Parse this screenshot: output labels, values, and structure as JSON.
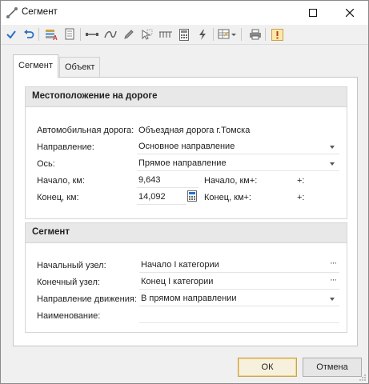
{
  "window": {
    "title": "Сегмент"
  },
  "toolbar": {
    "items": [
      "check-icon",
      "undo-icon",
      "layers-text-icon",
      "document-icon",
      "ruler-icon",
      "curve-icon",
      "pencil-icon",
      "select-arrow-icon",
      "measure-ticks-icon",
      "calculator-icon",
      "lightning-icon",
      "table-dropdown-icon",
      "printer-icon",
      "warning-icon"
    ]
  },
  "tabs": [
    {
      "label": "Сегмент",
      "active": true
    },
    {
      "label": "Объект",
      "active": false
    }
  ],
  "location": {
    "title": "Местоположение на дороге",
    "road_label": "Автомобильная дорога:",
    "road_value": "Объездная дорога г.Томска",
    "direction_label": "Направление:",
    "direction_value": "Основное направление",
    "axis_label": "Ось:",
    "axis_value": "Прямое направление",
    "start_km_label": "Начало, км:",
    "start_km_value": "9,643",
    "start_kmplus_label": "Начало, км+:",
    "start_kmplus_value": "+:",
    "end_km_label": "Конец, км:",
    "end_km_value": "14,092",
    "end_kmplus_label": "Конец, км+:",
    "end_kmplus_value": "+:"
  },
  "segment": {
    "title": "Сегмент",
    "start_node_label": "Начальный узел:",
    "start_node_value": "Начало I категории",
    "end_node_label": "Конечный узел:",
    "end_node_value": "Конец I категории",
    "move_dir_label": "Направление движения:",
    "move_dir_value": "В прямом направлении",
    "name_label": "Наименование:",
    "name_value": ""
  },
  "buttons": {
    "ok": "ОК",
    "cancel": "Отмена"
  },
  "colors": {
    "accent_blue": "#2a6fc9",
    "group_header": "#e8e8e8",
    "default_button_border": "#c9a24a"
  }
}
